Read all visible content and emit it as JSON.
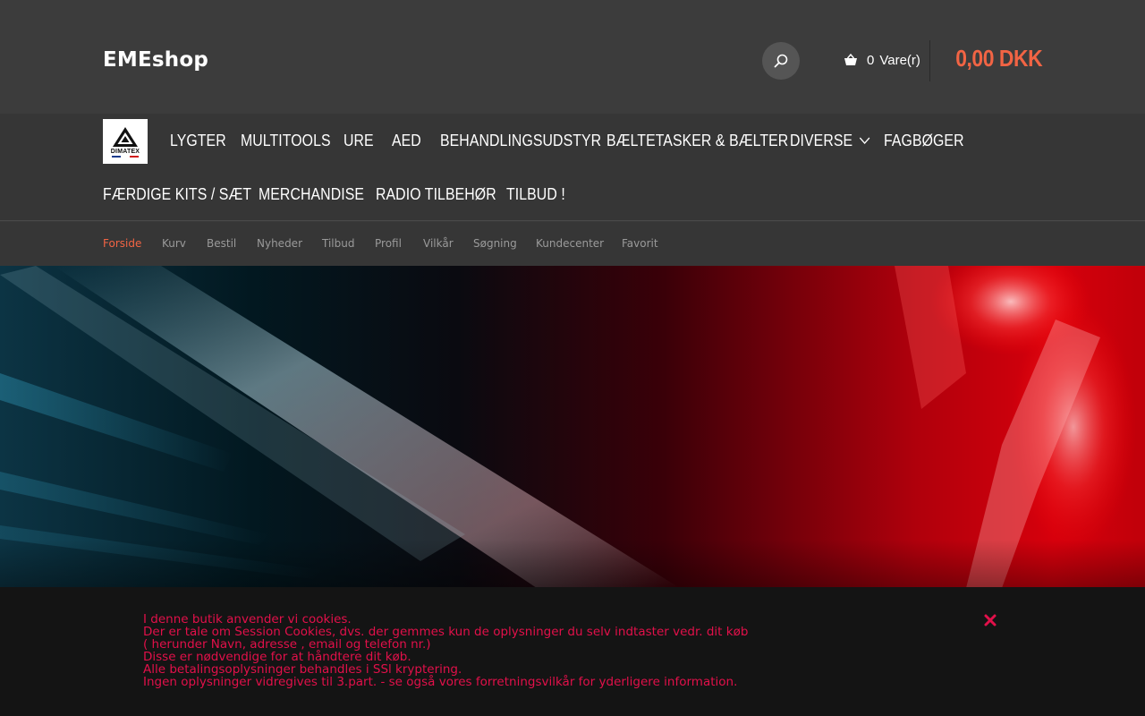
{
  "header": {
    "shop_name": "EMEshop",
    "cart_count": "0",
    "cart_label": "Vare(r)",
    "cart_total": "0,00 DKK"
  },
  "brand_logo": {
    "text": "DIMATEX"
  },
  "main_nav": [
    {
      "label": "LYGTER"
    },
    {
      "label": "MULTITOOLS"
    },
    {
      "label": "URE"
    },
    {
      "label": "AED"
    },
    {
      "label": "BEHANDLINGSUDSTYR"
    },
    {
      "label": "BÆLTETASKER & BÆLTER"
    },
    {
      "label": "DIVERSE",
      "has_dropdown": true
    },
    {
      "label": "FAGBØGER"
    },
    {
      "label": "FÆRDIGE KITS / SÆT"
    },
    {
      "label": "MERCHANDISE"
    },
    {
      "label": "RADIO TILBEHØR"
    },
    {
      "label": "TILBUD !"
    }
  ],
  "sub_nav": [
    {
      "label": "Forside",
      "active": true
    },
    {
      "label": "Kurv"
    },
    {
      "label": "Bestil"
    },
    {
      "label": "Nyheder"
    },
    {
      "label": "Tilbud"
    },
    {
      "label": "Profil"
    },
    {
      "label": "Vilkår"
    },
    {
      "label": "Søgning"
    },
    {
      "label": "Kundecenter"
    },
    {
      "label": "Favorit"
    }
  ],
  "cookie_notice": {
    "lines": [
      "I denne butik anvender vi cookies.",
      "Der er tale om Session Cookies, dvs. der gemmes kun de oplysninger du selv indtaster vedr. dit køb",
      "( herunder Navn, adresse , email og telefon nr.)",
      "Disse er nødvendige for at håndtere dit køb.",
      "Alle betalingsoplysninger behandles i SSl kryptering.",
      "Ingen oplysninger vidregives til 3.part. - se også vores forretningsvilkår for yderligere information."
    ]
  },
  "icons": {
    "search": "search-icon",
    "cart": "basket-icon",
    "dropdown": "chevron-down-icon",
    "close": "close-icon"
  },
  "colors": {
    "accent": "#f26444",
    "cookie_text": "#e2104a",
    "header_bg": "#3c3c3c",
    "nav_bg": "#363636"
  }
}
